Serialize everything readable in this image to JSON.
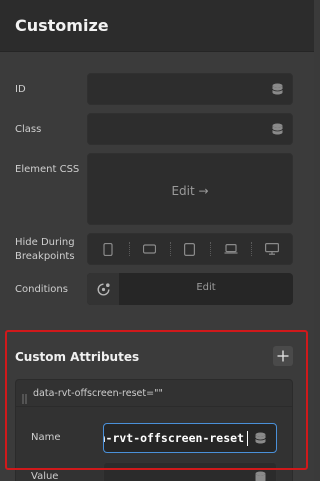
{
  "header": {
    "title": "Customize"
  },
  "rows": {
    "id_label": "ID",
    "class_label": "Class",
    "css_label": "Element CSS",
    "css_edit": "Edit →",
    "hide_label_line1": "Hide During",
    "hide_label_line2": "Breakpoints",
    "conditions_label": "Conditions",
    "conditions_edit": "Edit"
  },
  "breakpoints": [
    "mobile-portrait",
    "mobile-landscape",
    "tablet",
    "laptop",
    "desktop"
  ],
  "custom_attributes": {
    "title": "Custom Attributes",
    "item_summary": "data-rvt-offscreen-reset=\"\"",
    "name_label": "Name",
    "name_value": "a-rvt-offscreen-reset",
    "value_label": "Value"
  },
  "colors": {
    "highlight": "#d0191b",
    "focus": "#4a90d9"
  }
}
